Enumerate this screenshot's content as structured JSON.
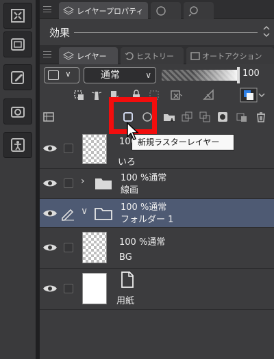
{
  "top_tabs": {
    "active": "レイヤープロパティ"
  },
  "effect": {
    "label": "効果"
  },
  "layer_panel_tabs": {
    "active": "レイヤー",
    "history": "ヒストリー",
    "auto_action": "オートアクション"
  },
  "blend": {
    "mode": "通常",
    "chevron": "∨",
    "opacity": "100"
  },
  "tooltip": {
    "text": "新規ラスターレイヤー"
  },
  "layers": [
    {
      "line1": "100",
      "line2": "いろ"
    },
    {
      "line1": "100 %通常",
      "line2": "線画",
      "expand_icon": "›"
    },
    {
      "line1": "100 %通常",
      "line2": "フォルダー 1",
      "expand_icon": "∨"
    },
    {
      "line1": "100 %通常",
      "line2": "BG"
    },
    {
      "line1": "",
      "line2": "用紙"
    }
  ],
  "icons": {
    "left_strip": [
      "fit-screen-icon",
      "layer-panel-icon",
      "navigator-edit-icon",
      "camera-icon",
      "person-icon"
    ],
    "row1": [
      "select-layer-icon",
      "lighthouse-icon",
      "clip-icon",
      "lock-icon",
      "lock-alpha-icon",
      "mask-icon",
      "ruler-icon",
      "color-icon"
    ],
    "row2": [
      "layer-settings-icon",
      "new-raster-layer-icon",
      "new-vector-layer-icon",
      "new-folder-icon",
      "copy-layer-icon",
      "merge-layer-icon",
      "mask-circle-icon",
      "apply-mask-icon",
      "trash-icon"
    ]
  },
  "colors": {
    "selected_row": "#4e5a73",
    "highlight": "#f20d0d"
  }
}
